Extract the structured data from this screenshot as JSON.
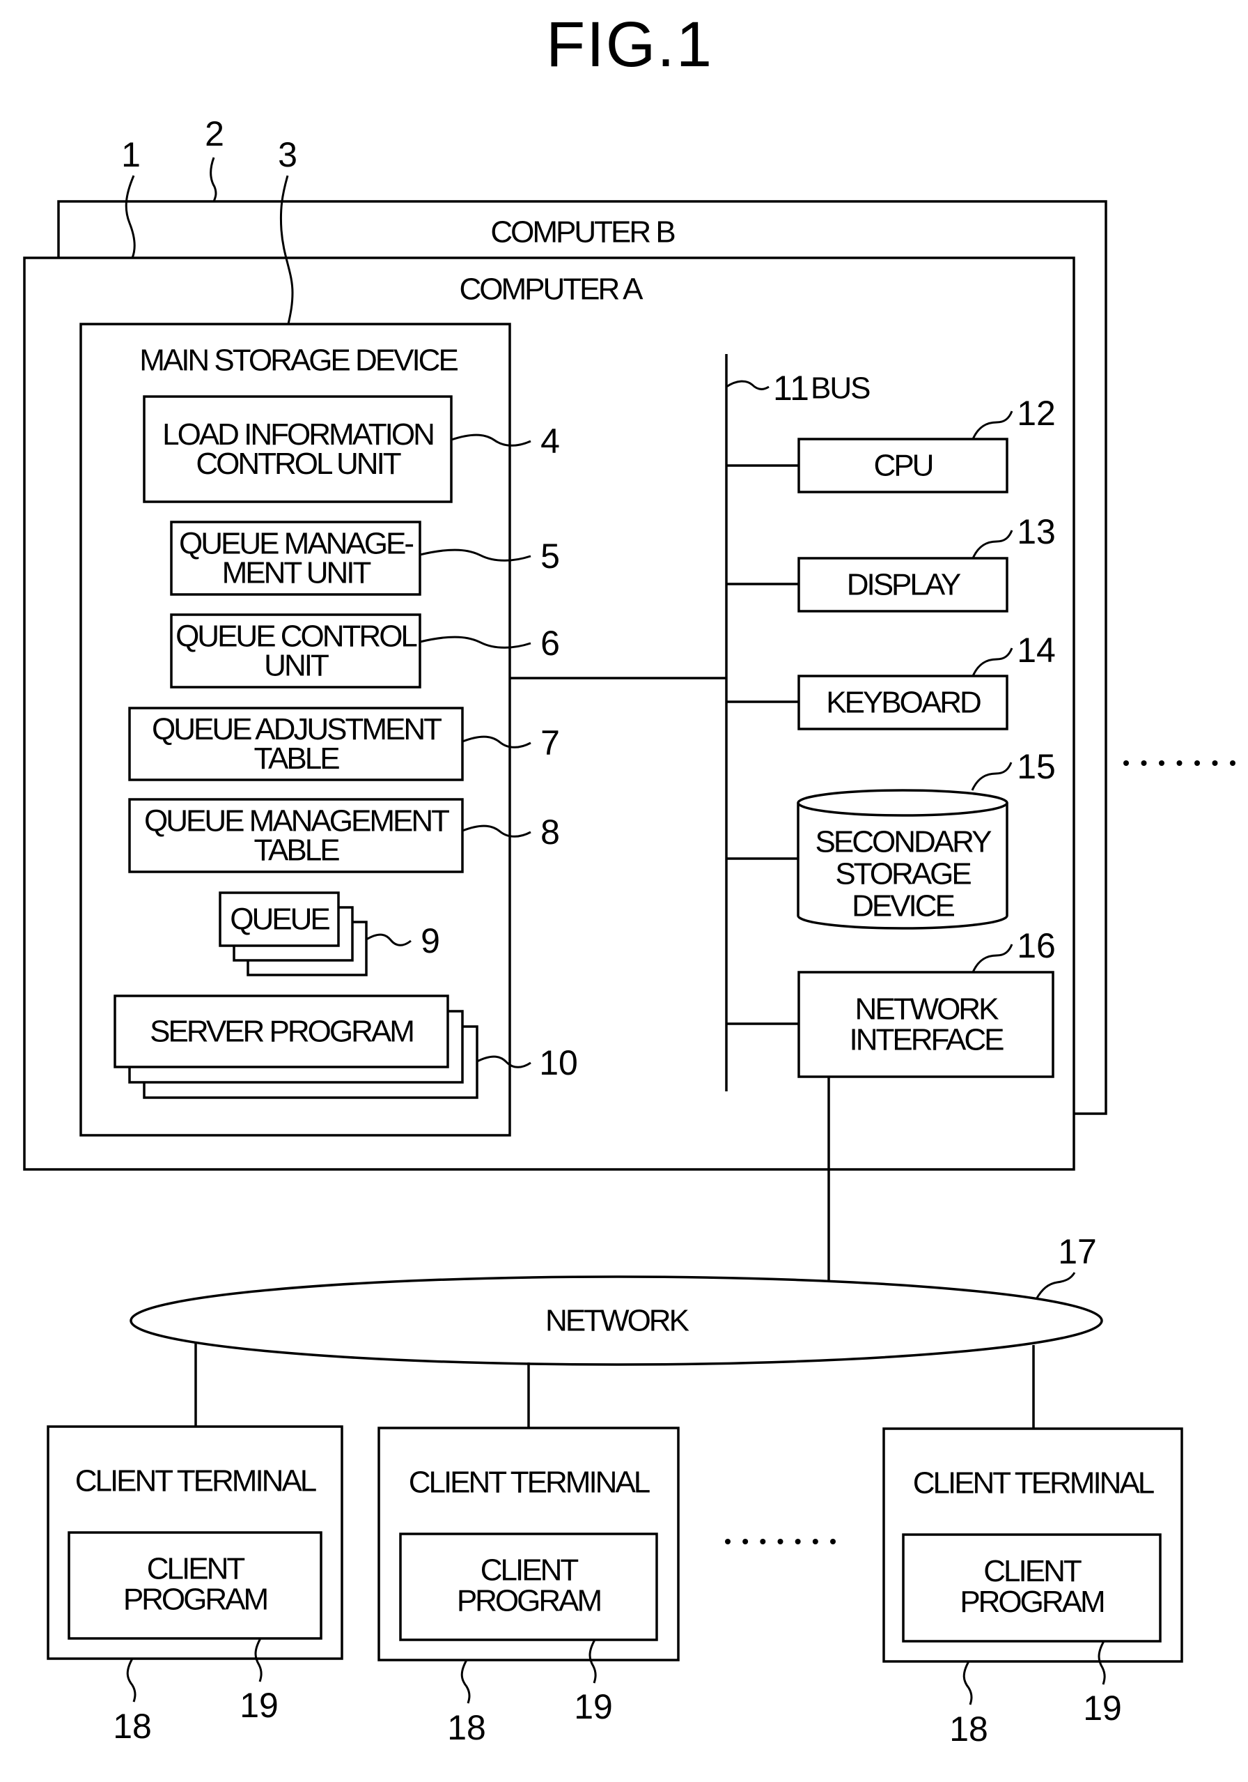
{
  "figure": {
    "title": "FIG.1"
  },
  "computers": {
    "computer_b": {
      "label": "COMPUTER B",
      "ref": "2"
    },
    "computer_a": {
      "label": "COMPUTER A",
      "ref": "1"
    }
  },
  "main_storage": {
    "label": "MAIN STORAGE DEVICE",
    "ref": "3",
    "units": [
      {
        "key": "load-information-control-unit",
        "lines": [
          "LOAD INFORMATION",
          "CONTROL UNIT"
        ],
        "ref": "4"
      },
      {
        "key": "queue-management-unit",
        "lines": [
          "QUEUE MANAGE-",
          "MENT UNIT"
        ],
        "ref": "5"
      },
      {
        "key": "queue-control-unit",
        "lines": [
          "QUEUE CONTROL",
          "UNIT"
        ],
        "ref": "6"
      },
      {
        "key": "queue-adjustment-table",
        "lines": [
          "QUEUE ADJUSTMENT",
          "TABLE"
        ],
        "ref": "7"
      },
      {
        "key": "queue-management-table",
        "lines": [
          "QUEUE MANAGEMENT",
          "TABLE"
        ],
        "ref": "8"
      },
      {
        "key": "queue",
        "lines": [
          "QUEUE"
        ],
        "ref": "9",
        "stacked": true
      },
      {
        "key": "server-program",
        "lines": [
          "SERVER PROGRAM"
        ],
        "ref": "10",
        "stacked": true
      }
    ]
  },
  "bus": {
    "ref": "11",
    "label": "BUS"
  },
  "devices": [
    {
      "key": "cpu",
      "lines": [
        "CPU"
      ],
      "ref": "12"
    },
    {
      "key": "display",
      "lines": [
        "DISPLAY"
      ],
      "ref": "13"
    },
    {
      "key": "keyboard",
      "lines": [
        "KEYBOARD"
      ],
      "ref": "14"
    },
    {
      "key": "secondary-storage-device",
      "lines": [
        "SECONDARY",
        "STORAGE",
        "DEVICE"
      ],
      "ref": "15",
      "shape": "cylinder"
    },
    {
      "key": "network-interface",
      "lines": [
        "NETWORK",
        "INTERFACE"
      ],
      "ref": "16"
    }
  ],
  "network": {
    "label": "NETWORK",
    "ref": "17"
  },
  "clients": [
    {
      "terminal_label": "CLIENT TERMINAL",
      "program_lines": [
        "CLIENT",
        "PROGRAM"
      ],
      "terminal_ref": "18",
      "program_ref": "19"
    },
    {
      "terminal_label": "CLIENT TERMINAL",
      "program_lines": [
        "CLIENT",
        "PROGRAM"
      ],
      "terminal_ref": "18",
      "program_ref": "19"
    },
    {
      "terminal_label": "CLIENT TERMINAL",
      "program_lines": [
        "CLIENT",
        "PROGRAM"
      ],
      "terminal_ref": "18",
      "program_ref": "19"
    }
  ],
  "ellipsis": {
    "computers_more": ".......",
    "clients_more": "......."
  }
}
